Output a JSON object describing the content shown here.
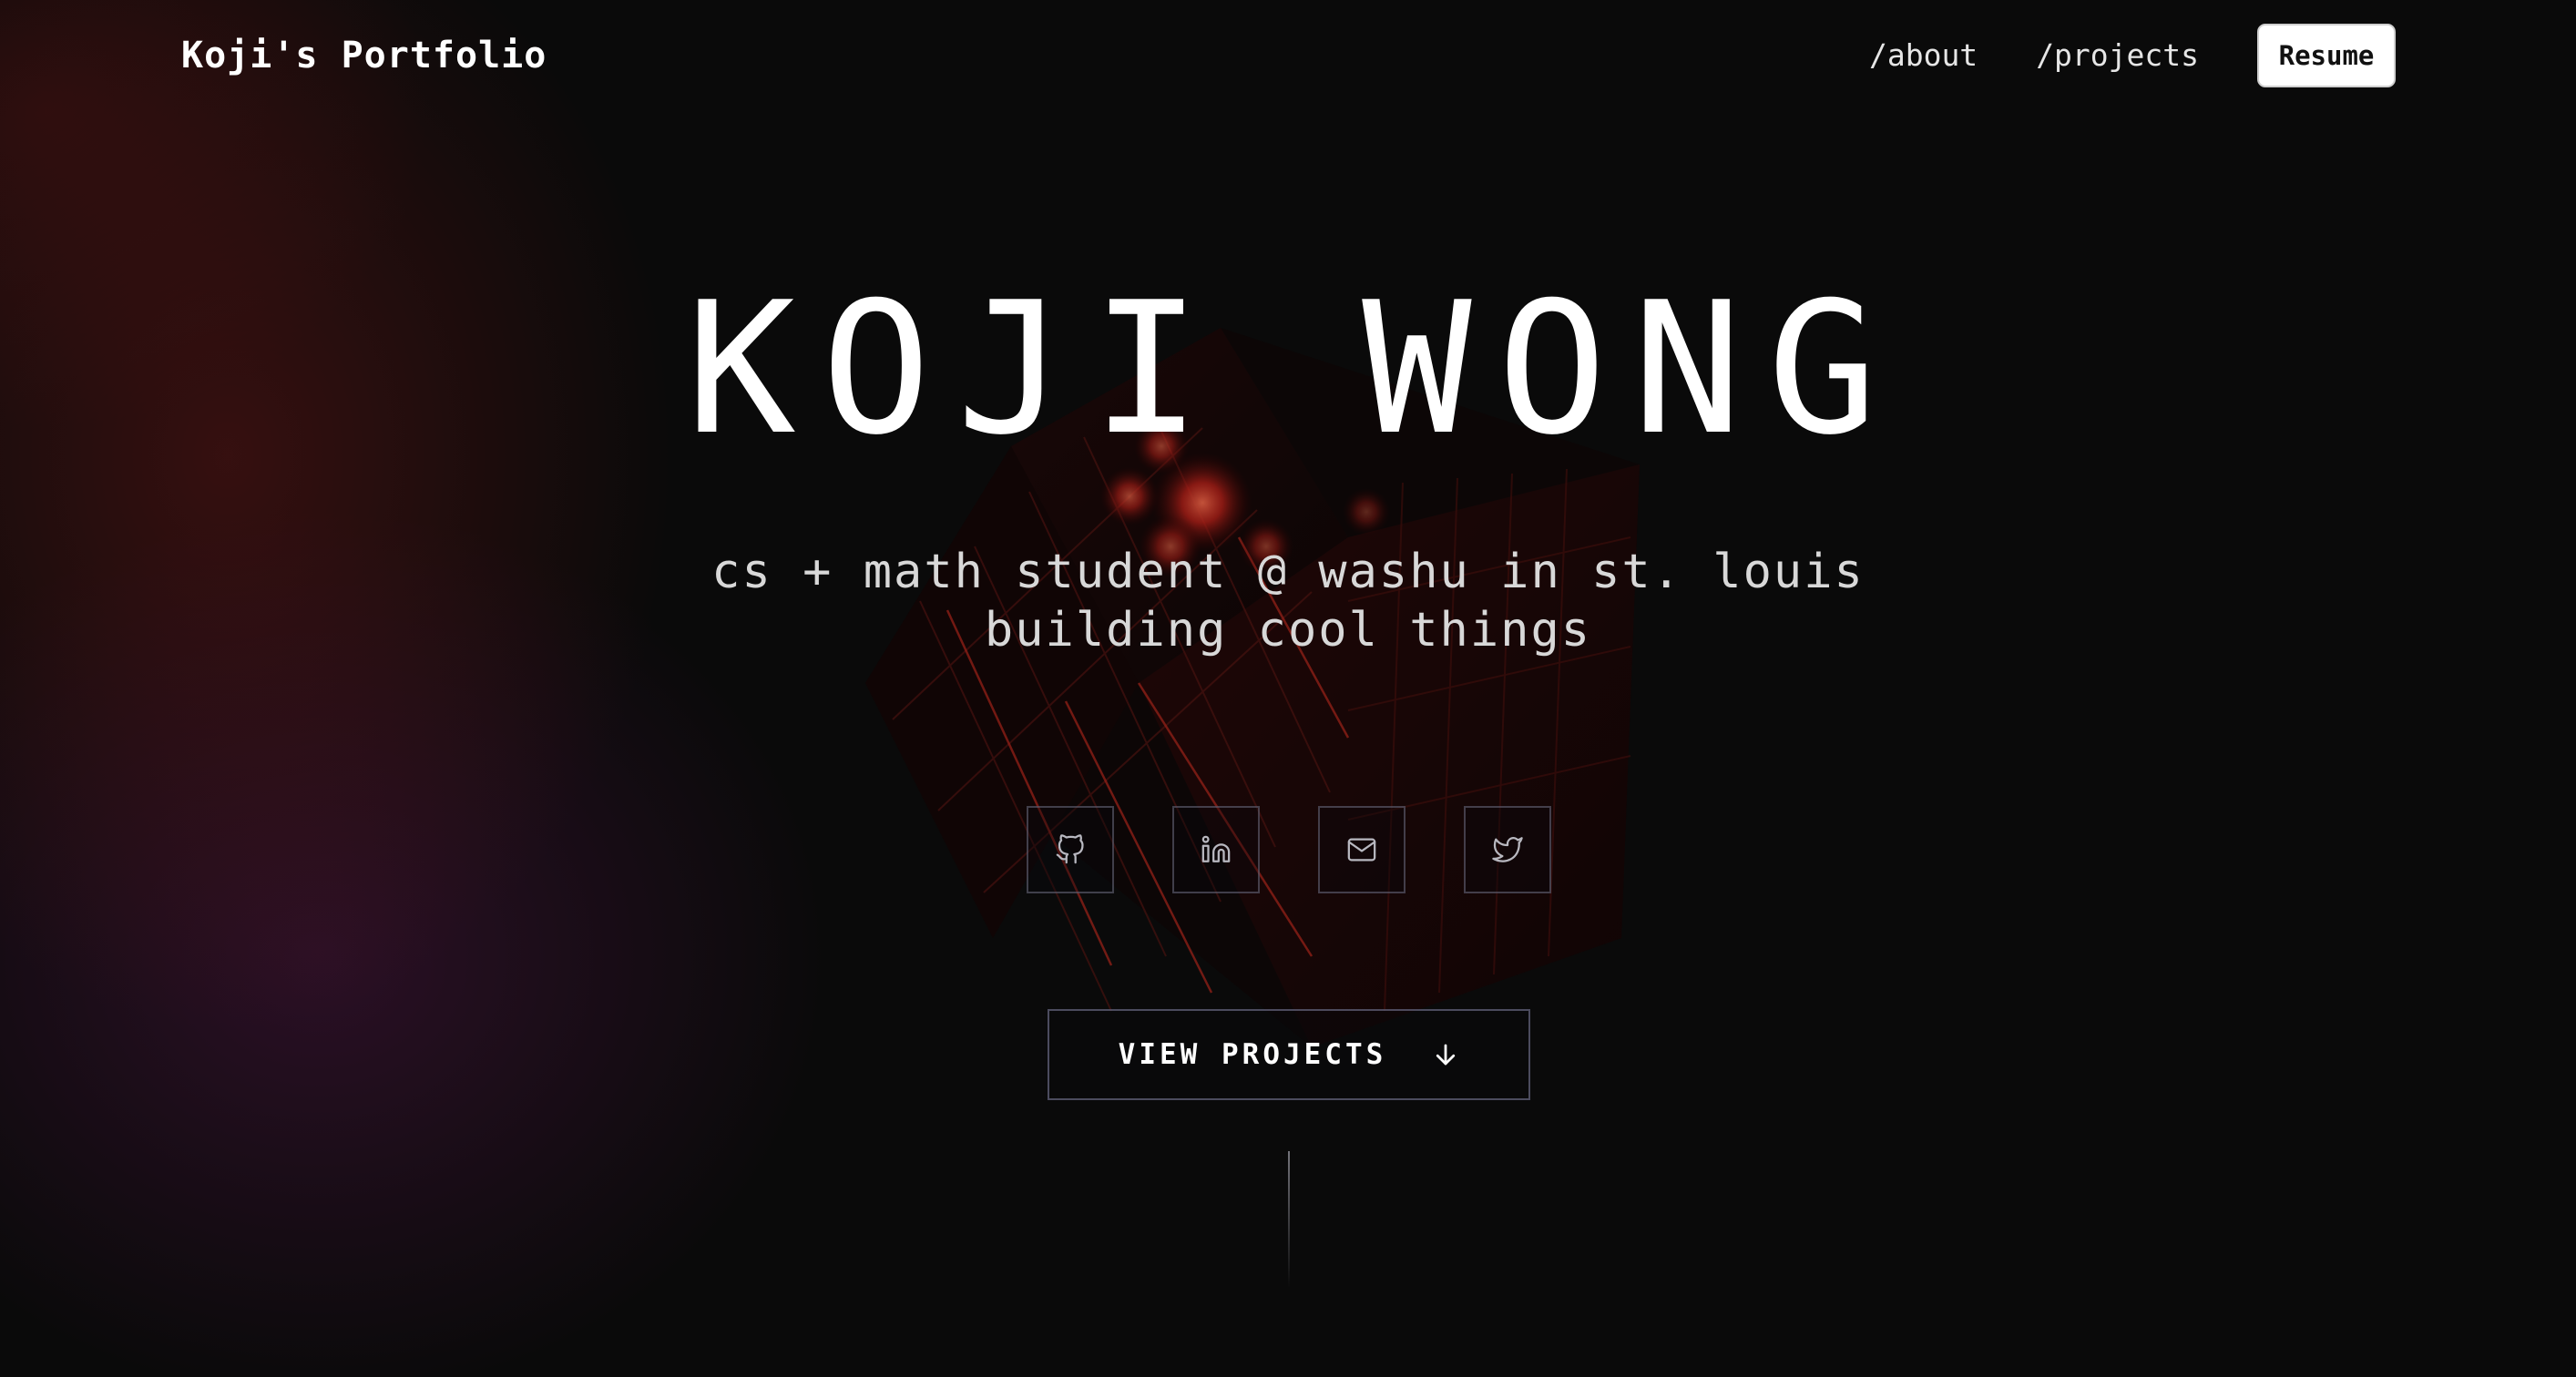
{
  "header": {
    "brand": "Koji's Portfolio",
    "nav": [
      {
        "label": "/about"
      },
      {
        "label": "/projects"
      }
    ],
    "resume_label": "Resume"
  },
  "hero": {
    "name": "KOJI WONG",
    "subtitle_line1": "cs + math student @ washu in st. louis",
    "subtitle_line2": "building cool things"
  },
  "socials": [
    {
      "icon": "github-icon"
    },
    {
      "icon": "linkedin-icon"
    },
    {
      "icon": "mail-icon"
    },
    {
      "icon": "twitter-icon"
    }
  ],
  "cta": {
    "label": "VIEW PROJECTS",
    "icon": "arrow-down-icon"
  },
  "colors": {
    "background": "#0a0a0a",
    "accent_red": "#ff3b2f",
    "cube_dark": "#1a0505"
  }
}
